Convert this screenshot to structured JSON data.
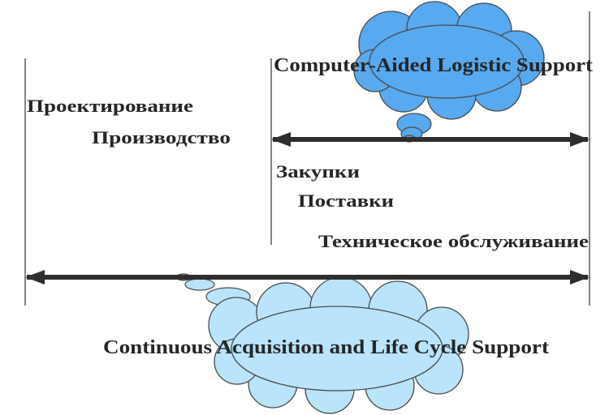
{
  "cloud_top_text": "Computer-Aided Logistic Support",
  "cloud_bottom_text": "Continuous Acquisition and Life Cycle Support",
  "stages": {
    "design": "Проектирование",
    "production": "Производство",
    "purchasing": "Закупки",
    "supply": "Поставки",
    "maintenance": "Техническое обслуживание"
  },
  "colors": {
    "cloud_top_fill": "#57a9f0",
    "cloud_bottom_fill": "#b9e4fb",
    "cloud_outline": "#4a4a4a",
    "arrow": "#2e2e2e",
    "guide_line": "#333333"
  }
}
